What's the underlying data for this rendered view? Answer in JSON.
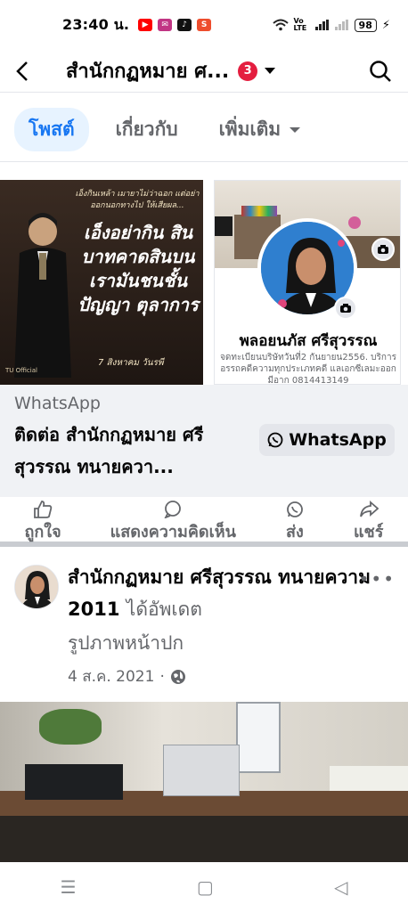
{
  "status_bar": {
    "time": "23:40 น.",
    "apps": [
      {
        "icon": "youtube-icon",
        "color": "#ff0000",
        "glyph": "▶"
      },
      {
        "icon": "messenger-icon",
        "color": "#c13584",
        "glyph": "✉"
      },
      {
        "icon": "tiktok-icon",
        "color": "#111111",
        "glyph": "♪"
      },
      {
        "icon": "shopee-icon",
        "color": "#ee4d2d",
        "glyph": "S"
      }
    ],
    "volte": "Vo LTE",
    "battery": "98"
  },
  "top_nav": {
    "title": "สำนักกฏหมาย ศ...",
    "notification_count": "3"
  },
  "tabs": [
    {
      "label": "โพสต์",
      "active": true
    },
    {
      "label": "เกี่ยวกับ",
      "active": false
    },
    {
      "label": "เพิ่มเติม",
      "active": false
    }
  ],
  "ad_card": {
    "image_left": {
      "small_text": "เอ็งกินเหล้า เมายาไม่ว่าฉอก แต่อย่าออกนอกทางไป ให้เสียผล...",
      "big_text": "เอ็งอย่ากิน สินบาทคาดสินบน เรามันชนชั้นปัญญา ตุลาการ",
      "date_text": "7 สิงหาคม วันรพี",
      "logo_text": "TU Official"
    },
    "image_right": {
      "profile_name": "พลอยนภัส ศรีสุวรรณ",
      "bio": "จดทะเบียนบริษัทวันที่2 กันยายน2556. บริการอรรถคดีความทุกประเภทคดี แลเอกซีเลมะออกมีอาก 0814413149"
    },
    "source": "WhatsApp",
    "headline": "ติดต่อ สำนักกฏหมาย ศรีสุวรรณ ทนายควา...",
    "cta_label": "WhatsApp"
  },
  "actions": [
    {
      "label": "ถูกใจ",
      "icon": "like-icon"
    },
    {
      "label": "แสดงความคิดเห็น",
      "icon": "comment-icon"
    },
    {
      "label": "ส่ง",
      "icon": "whatsapp-send-icon"
    },
    {
      "label": "แชร์",
      "icon": "share-icon"
    }
  ],
  "post": {
    "author": "สำนักกฏหมาย ศรีสุวรรณ ทนายความ 2011",
    "action_text": "ได้อัพเดต",
    "subline": "รูปภาพหน้าปก",
    "date": "4 ส.ค. 2021",
    "separator": "·",
    "privacy_icon": "globe-icon",
    "more_label": "•••"
  },
  "system_nav": {
    "recents": "☰",
    "home": "▢",
    "back": "◁"
  },
  "colors": {
    "accent": "#1877f2",
    "tab_active_bg": "#e7f3ff",
    "badge": "#e41e3f",
    "secondary_text": "#65676b",
    "panel_bg": "#f0f2f5"
  }
}
